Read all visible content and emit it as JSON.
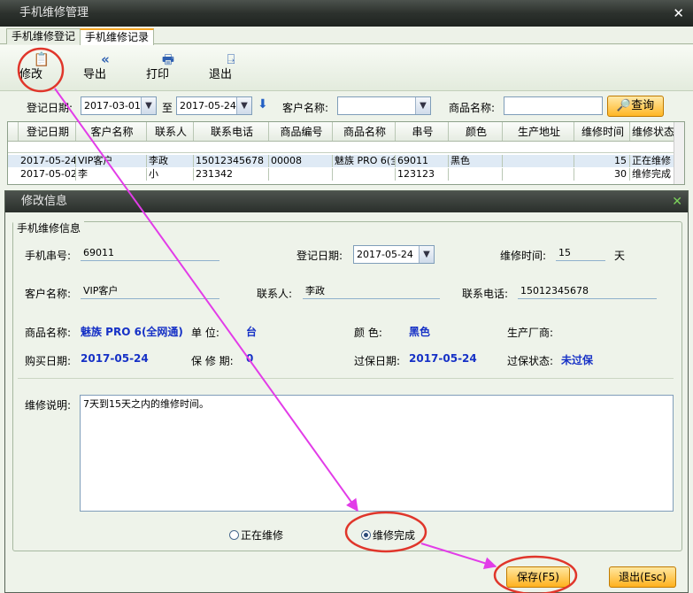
{
  "window": {
    "title": "手机维修管理"
  },
  "tabs": [
    "手机维修登记",
    "手机维修记录"
  ],
  "toolbar": {
    "modify": "修改",
    "export": "导出",
    "print": "打印",
    "exit": "退出"
  },
  "filter": {
    "reg_date_label": "登记日期:",
    "date_from": "2017-03-01",
    "to_label": "至",
    "date_to": "2017-05-24",
    "customer_label": "客户名称:",
    "customer_value": "",
    "product_label": "商品名称:",
    "product_value": "",
    "query": "查询"
  },
  "grid": {
    "columns": [
      "登记日期",
      "客户名称",
      "联系人",
      "联系电话",
      "商品编号",
      "商品名称",
      "串号",
      "颜色",
      "生产地址",
      "维修时间",
      "维修状态"
    ],
    "rows": [
      [
        "2017-05-24",
        "VIP客户",
        "李政",
        "15012345678",
        "00008",
        "魅族 PRO 6(全",
        "69011",
        "黑色",
        "",
        "15",
        "正在维修"
      ],
      [
        "2017-05-02",
        "李",
        "小",
        "231342",
        "",
        "",
        "123123",
        "",
        "",
        "30",
        "维修完成"
      ]
    ]
  },
  "dialog": {
    "title": "修改信息",
    "group": "手机维修信息",
    "serial_label": "手机串号:",
    "serial": "69011",
    "reg_date_label": "登记日期:",
    "reg_date": "2017-05-24",
    "repair_time_label": "维修时间:",
    "repair_time": "15",
    "days_unit": "天",
    "customer_label": "客户名称:",
    "customer": "VIP客户",
    "contact_label": "联系人:",
    "contact": "李政",
    "phone_label": "联系电话:",
    "phone": "15012345678",
    "product_label": "商品名称:",
    "product": "魅族 PRO 6(全网通)",
    "unit_label": "单  位:",
    "unit": "台",
    "color_label": "颜  色:",
    "color": "黑色",
    "maker_label": "生产厂商:",
    "maker": "",
    "buy_date_label": "购买日期:",
    "buy_date": "2017-05-24",
    "warranty_label": "保 修 期:",
    "warranty": "0",
    "expiry_label": "过保日期:",
    "expiry": "2017-05-24",
    "status_label": "过保状态:",
    "status": "未过保",
    "desc_label": "维修说明:",
    "desc": "7天到15天之内的维修时间。",
    "radio_repairing": "正在维修",
    "radio_done": "维修完成",
    "save": "保存(F5)",
    "exit": "退出(Esc)"
  },
  "colors": {
    "annotation_circle": "#e0362b",
    "annotation_arrow": "#e23ce8"
  }
}
